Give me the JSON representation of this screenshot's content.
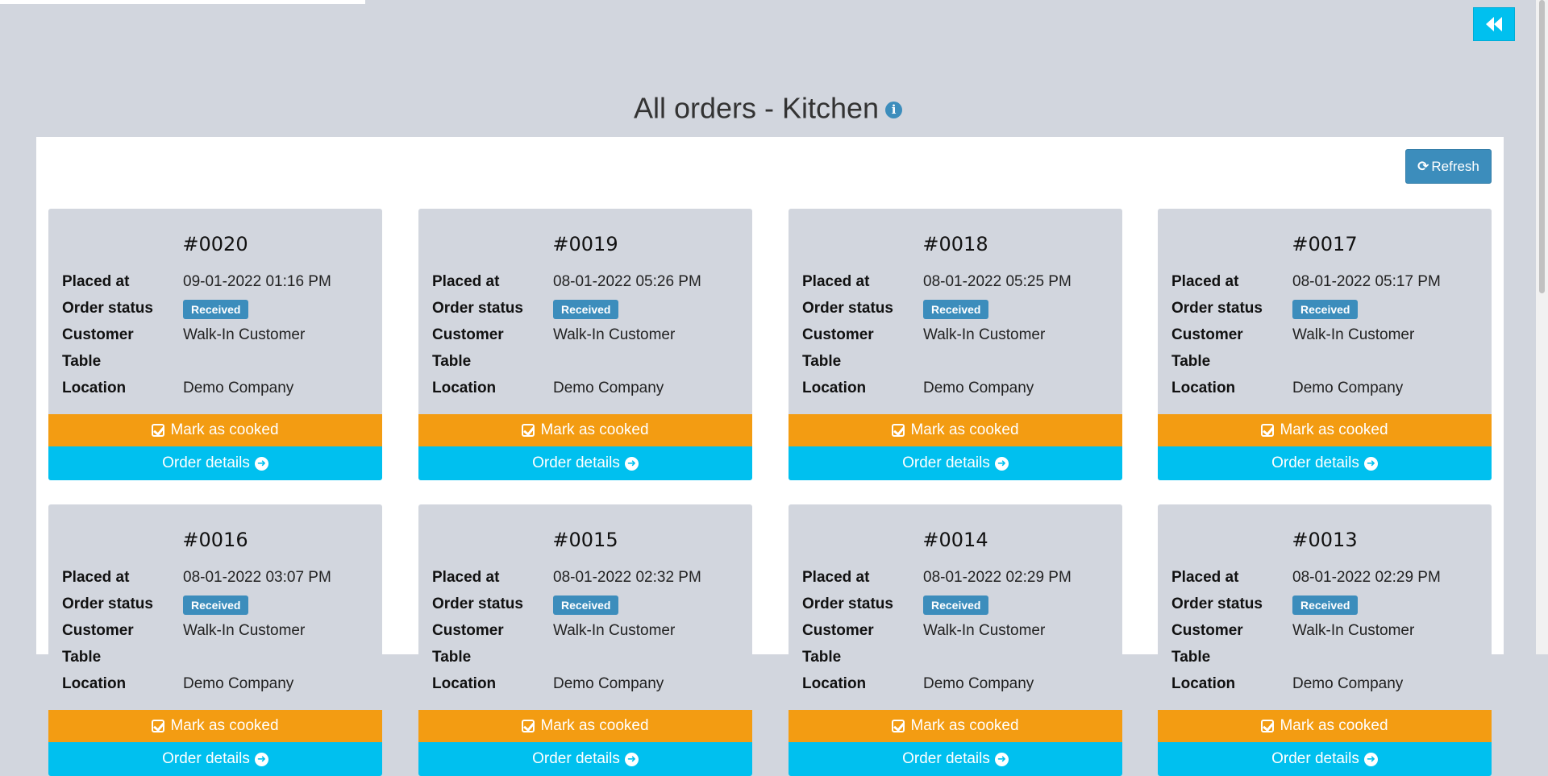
{
  "page": {
    "title": "All orders - Kitchen",
    "back_icon": "angle-double-left-icon",
    "info_icon": "info-circle-icon",
    "info_glyph": "i"
  },
  "toolbar": {
    "refresh_label": "Refresh",
    "refresh_icon": "refresh-icon"
  },
  "labels": {
    "placed_at": "Placed at",
    "order_status": "Order status",
    "customer": "Customer",
    "table": "Table",
    "location": "Location",
    "mark_as_cooked": "Mark as cooked",
    "order_details": "Order details"
  },
  "colors": {
    "background": "#d2d6de",
    "primary": "#3c8dbc",
    "warning": "#f39c12",
    "info": "#00c0ef"
  },
  "orders": [
    {
      "number": "#0020",
      "placed_at": "09-01-2022 01:16 PM",
      "status": "Received",
      "customer": "Walk-In Customer",
      "table": "",
      "location": "Demo Company"
    },
    {
      "number": "#0019",
      "placed_at": "08-01-2022 05:26 PM",
      "status": "Received",
      "customer": "Walk-In Customer",
      "table": "",
      "location": "Demo Company"
    },
    {
      "number": "#0018",
      "placed_at": "08-01-2022 05:25 PM",
      "status": "Received",
      "customer": "Walk-In Customer",
      "table": "",
      "location": "Demo Company"
    },
    {
      "number": "#0017",
      "placed_at": "08-01-2022 05:17 PM",
      "status": "Received",
      "customer": "Walk-In Customer",
      "table": "",
      "location": "Demo Company"
    },
    {
      "number": "#0016",
      "placed_at": "08-01-2022 03:07 PM",
      "status": "Received",
      "customer": "Walk-In Customer",
      "table": "",
      "location": "Demo Company"
    },
    {
      "number": "#0015",
      "placed_at": "08-01-2022 02:32 PM",
      "status": "Received",
      "customer": "Walk-In Customer",
      "table": "",
      "location": "Demo Company"
    },
    {
      "number": "#0014",
      "placed_at": "08-01-2022 02:29 PM",
      "status": "Received",
      "customer": "Walk-In Customer",
      "table": "",
      "location": "Demo Company"
    },
    {
      "number": "#0013",
      "placed_at": "08-01-2022 02:29 PM",
      "status": "Received",
      "customer": "Walk-In Customer",
      "table": "",
      "location": "Demo Company"
    }
  ]
}
